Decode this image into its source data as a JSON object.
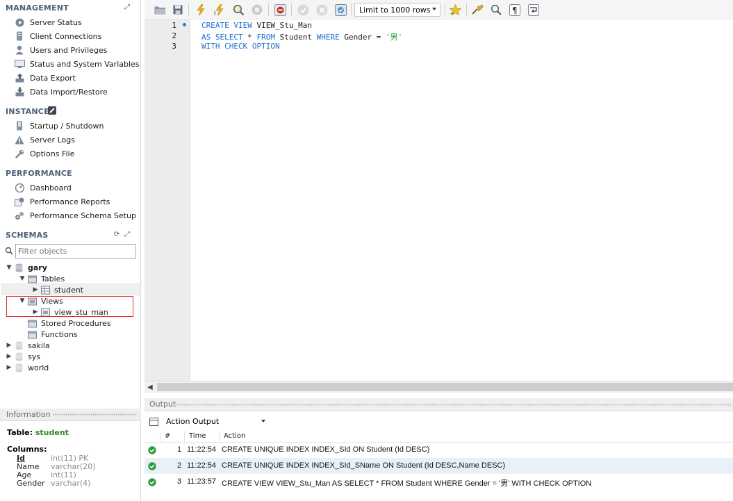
{
  "sidebar": {
    "management": {
      "title": "MANAGEMENT",
      "items": [
        "Server Status",
        "Client Connections",
        "Users and Privileges",
        "Status and System Variables",
        "Data Export",
        "Data Import/Restore"
      ]
    },
    "instance": {
      "title": "INSTANCE",
      "items": [
        "Startup / Shutdown",
        "Server Logs",
        "Options File"
      ]
    },
    "performance": {
      "title": "PERFORMANCE",
      "items": [
        "Dashboard",
        "Performance Reports",
        "Performance Schema Setup"
      ]
    },
    "schemas": {
      "title": "SCHEMAS",
      "filter_placeholder": "Filter objects",
      "tree": {
        "gary": "gary",
        "tables": "Tables",
        "student": "student",
        "views": "Views",
        "view_stu_man": "view_stu_man",
        "procedures": "Stored Procedures",
        "functions": "Functions",
        "sakila": "sakila",
        "sys": "sys",
        "world": "world"
      }
    }
  },
  "info": {
    "header": "Information",
    "table_label": "Table:",
    "table_name": "student",
    "columns_label": "Columns:",
    "columns": [
      {
        "name": "Id",
        "type": "int(11) PK"
      },
      {
        "name": "Name",
        "type": "varchar(20)"
      },
      {
        "name": "Age",
        "type": "int(11)"
      },
      {
        "name": "Gender",
        "type": "varchar(4)"
      }
    ]
  },
  "toolbar": {
    "limit": "Limit to 1000 rows"
  },
  "editor": {
    "line_numbers": [
      "1",
      "2",
      "3"
    ],
    "line1": {
      "kw1": "CREATE VIEW ",
      "id1": "VIEW_Stu_Man"
    },
    "line2": {
      "kw1": "AS SELECT ",
      "id1": "* ",
      "kw2": "FROM ",
      "id2": "Student ",
      "kw3": "WHERE ",
      "id3": "Gender = ",
      "str": "'男'"
    },
    "line3": {
      "kw1": "WITH CHECK OPTION"
    }
  },
  "output": {
    "title": "Output",
    "select_value": "Action Output",
    "headers": {
      "num": "#",
      "time": "Time",
      "action": "Action"
    },
    "rows": [
      {
        "num": "1",
        "time": "11:22:54",
        "action": "CREATE UNIQUE INDEX INDEX_SId ON Student (Id DESC)"
      },
      {
        "num": "2",
        "time": "11:22:54",
        "action": "CREATE UNIQUE INDEX INDEX_SId_SName ON Student (Id DESC,Name DESC)"
      },
      {
        "num": "3",
        "time": "11:23:57",
        "action": "CREATE VIEW VIEW_Stu_Man AS SELECT * FROM Student WHERE Gender = '男' WITH CHECK OPTION"
      }
    ]
  },
  "colors": {
    "accent": "#1f6fd1",
    "success": "#2f9d3a",
    "highlight_border": "#e0302c",
    "section_header": "#4c5f77"
  }
}
